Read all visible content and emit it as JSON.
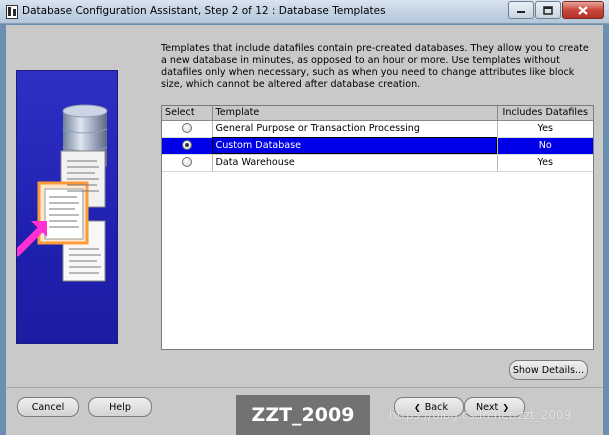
{
  "window": {
    "title": "Database Configuration Assistant, Step 2 of 12 : Database Templates",
    "controls": {
      "minimize": "minimize-icon",
      "maximize": "maximize-icon",
      "close": "close-icon"
    }
  },
  "description": "Templates that include datafiles contain pre-created databases. They allow you to create a new database in minutes, as opposed to an hour or more. Use templates without datafiles only when necessary, such as when you need to change attributes like block size, which cannot be altered after database creation.",
  "table": {
    "headers": [
      "Select",
      "Template",
      "Includes Datafiles"
    ],
    "rows": [
      {
        "template": "General Purpose or Transaction Processing",
        "includes_datafiles": "Yes",
        "selected": false
      },
      {
        "template": "Custom Database",
        "includes_datafiles": "No",
        "selected": true
      },
      {
        "template": "Data Warehouse",
        "includes_datafiles": "Yes",
        "selected": false
      }
    ]
  },
  "buttons": {
    "show_details": "Show Details...",
    "cancel": "Cancel",
    "help": "Help",
    "back": "Back",
    "next": "Next"
  },
  "watermark": {
    "label": "ZZT_2009",
    "url": "https://blog.csdn.net/zzt_2009"
  },
  "colors": {
    "selection": "#0000e8",
    "illustration_bg": "#2020b0",
    "dialog_bg": "#c9c9c9"
  }
}
